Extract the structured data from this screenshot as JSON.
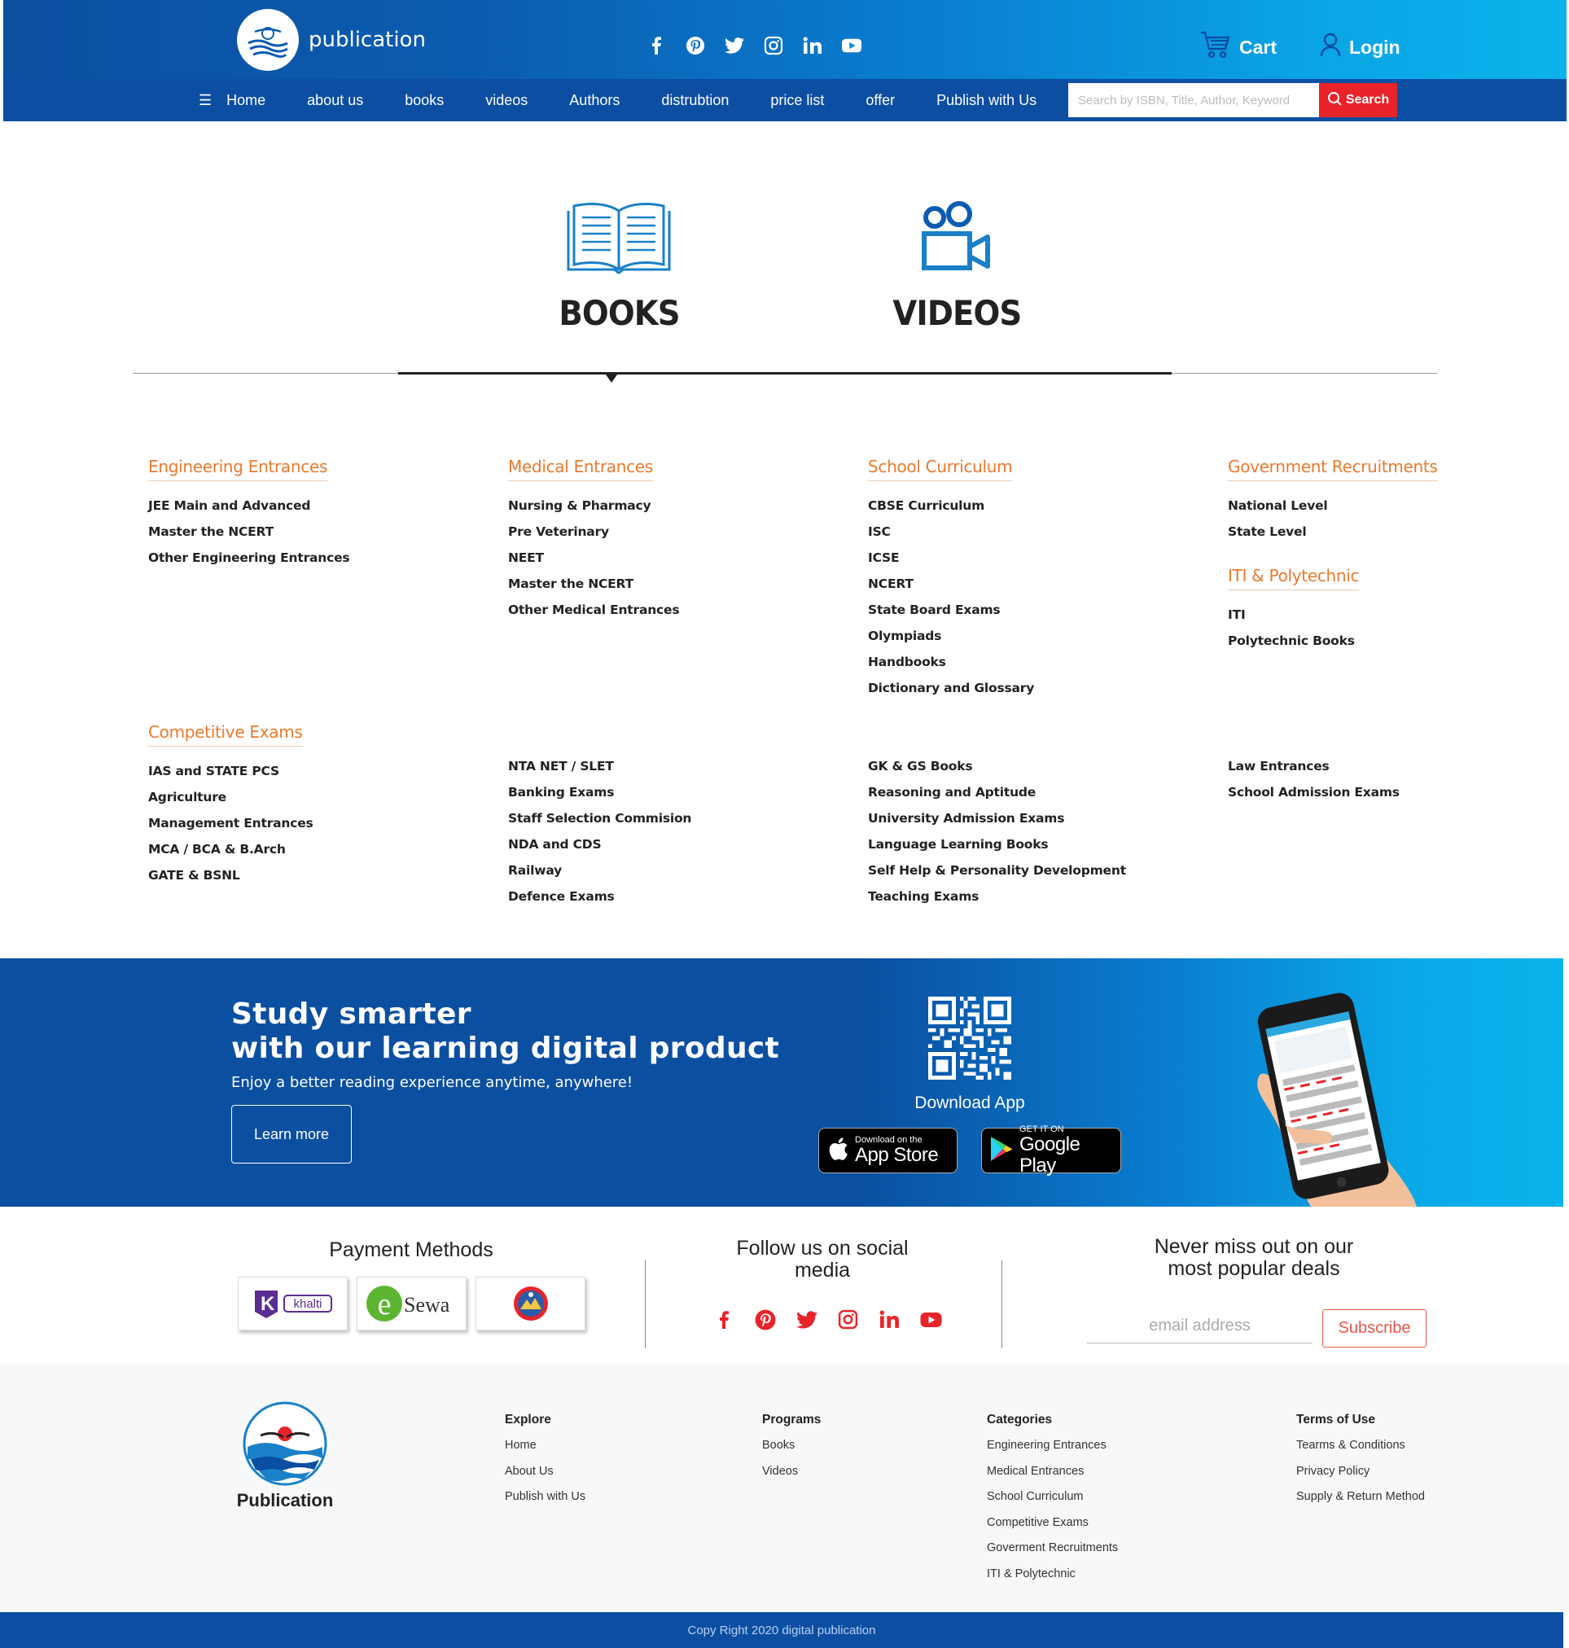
{
  "header": {
    "logo_text": "publication",
    "cart_label": "Cart",
    "login_label": "Login",
    "social_icons": [
      "facebook-icon",
      "pinterest-icon",
      "twitter-icon",
      "instagram-icon",
      "linkedin-icon",
      "youtube-icon"
    ]
  },
  "nav": {
    "items": [
      "Home",
      "about us",
      "books",
      "videos",
      "Authors",
      "distrubtion",
      "price list",
      "offer",
      "Publish with Us"
    ],
    "search_placeholder": "Search by ISBN, Title, Author, Keyword",
    "search_button": "Search"
  },
  "tabs": {
    "books": "BOOKS",
    "videos": "VIDEOS",
    "active": "BOOKS"
  },
  "categories": {
    "row1": [
      {
        "title": "Engineering Entrances",
        "items": [
          "JEE Main and Advanced",
          "Master the NCERT",
          "Other Engineering Entrances"
        ]
      },
      {
        "title": "Medical Entrances",
        "items": [
          "Nursing & Pharmacy",
          "Pre Veterinary",
          "NEET",
          "Master the NCERT",
          "Other Medical Entrances"
        ]
      },
      {
        "title": "School Curriculum",
        "items": [
          "CBSE Curriculum",
          "ISC",
          "ICSE",
          "NCERT",
          "State Board Exams",
          "Olympiads",
          "Handbooks",
          "Dictionary and Glossary"
        ]
      },
      {
        "title": "Government Recruitments",
        "items": [
          "National Level",
          "State Level"
        ]
      }
    ],
    "iti": {
      "title": "ITI & Polytechnic",
      "items": [
        "ITI",
        "Polytechnic Books"
      ]
    },
    "competitive": {
      "title": "Competitive Exams",
      "columns": [
        [
          "IAS and STATE PCS",
          "Agriculture",
          "Management Entrances",
          "MCA / BCA & B.Arch",
          "GATE & BSNL"
        ],
        [
          "NTA NET / SLET",
          "Banking Exams",
          "Staff Selection Commision",
          "NDA and CDS",
          "Railway",
          "Defence Exams"
        ],
        [
          "GK & GS Books",
          "Reasoning and Aptitude",
          "University Admission Exams",
          "Language Learning Books",
          "Self Help & Personality Development",
          "Teaching Exams"
        ],
        [
          "Law Entrances",
          "School Admission Exams"
        ]
      ]
    }
  },
  "banner": {
    "headline_1": "Study smarter",
    "headline_2": "with our learning digital product",
    "subtext": "Enjoy a better reading  experience anytime, anywhere!",
    "learn_more": "Learn more",
    "download_app": "Download App",
    "appstore_small": "Download on the",
    "appstore_big": "App Store",
    "gplay_small": "GET IT ON",
    "gplay_big": "Google Play"
  },
  "payment": {
    "title": "Payment Methods",
    "methods": [
      "khalti",
      "Sewa"
    ]
  },
  "follow": {
    "title_1": "Follow us on social",
    "title_2": "media",
    "icons": [
      "facebook-icon",
      "pinterest-icon",
      "twitter-icon",
      "instagram-icon",
      "linkedin-icon",
      "youtube-icon"
    ]
  },
  "subscribe": {
    "title_1": "Never miss out on our",
    "title_2": "most popular deals",
    "email_placeholder": "email address",
    "button": "Subscribe"
  },
  "footer": {
    "logo_text": "Publication",
    "explore": {
      "title": "Explore",
      "items": [
        "Home",
        "About Us",
        "Publish with Us"
      ]
    },
    "programs": {
      "title": "Programs",
      "items": [
        "Books",
        "Videos"
      ]
    },
    "categories": {
      "title": "Categories",
      "items": [
        "Engineering Entrances",
        "Medical Entrances",
        "School Curriculum",
        "Competitive Exams",
        "Goverment Recruitments",
        "ITI & Polytechnic"
      ]
    },
    "terms": {
      "title": "Terms of Use",
      "items": [
        "Tearms & Conditions",
        "Privacy Policy",
        "Supply & Return Method"
      ]
    },
    "copyright": "Copy Right 2020 digital publication"
  },
  "colors": {
    "primary_blue": "#0b4ea2",
    "light_blue": "#0bb3ec",
    "accent_orange": "#e87a2e",
    "search_red": "#e8232a",
    "social_red": "#e8232a"
  }
}
